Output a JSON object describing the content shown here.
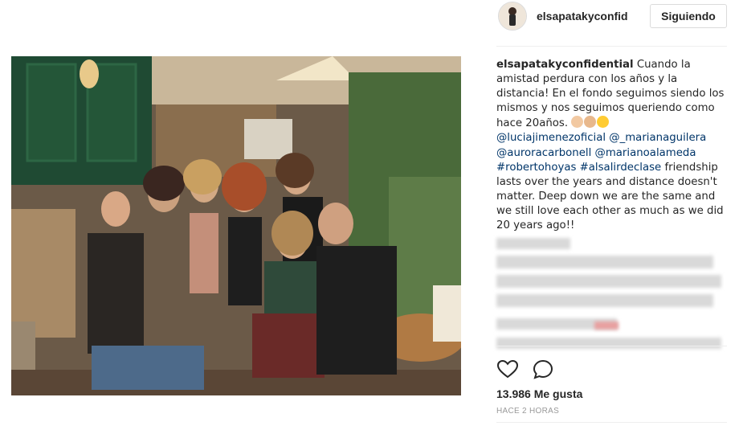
{
  "post": {
    "username": "elsapatakyconfid",
    "follow_label": "Siguiendo",
    "caption": {
      "author": "elsapatakyconfidential",
      "text": " Cuando la amistad perdura con los años y la distancia! En el fondo seguimos siendo los mismos y nos seguimos queriendo como hace 20años. ",
      "emojis": [
        "clapping-hands-emoji",
        "flexed-biceps-emoji",
        "face-blowing-kiss-emoji"
      ],
      "mentions": [
        "@luciajimenezoficial",
        "@_marianaguilera",
        "@auroracarbonell",
        "@marianoalameda",
        "#robertohoyas",
        "#alsalirdeclase"
      ],
      "text_en": " friendship lasts over the years and distance doesn't matter. Deep down we are the same and we still love each other as much as we did 20 years ago!!"
    },
    "likes": "13.986 Me gusta",
    "timestamp": "HACE 2 HORAS",
    "icons": {
      "like": "heart-icon",
      "comment": "comment-icon"
    },
    "colors": {
      "text": "#262626",
      "link": "#003569",
      "muted": "#999999",
      "border": "#dbdbdb"
    }
  }
}
